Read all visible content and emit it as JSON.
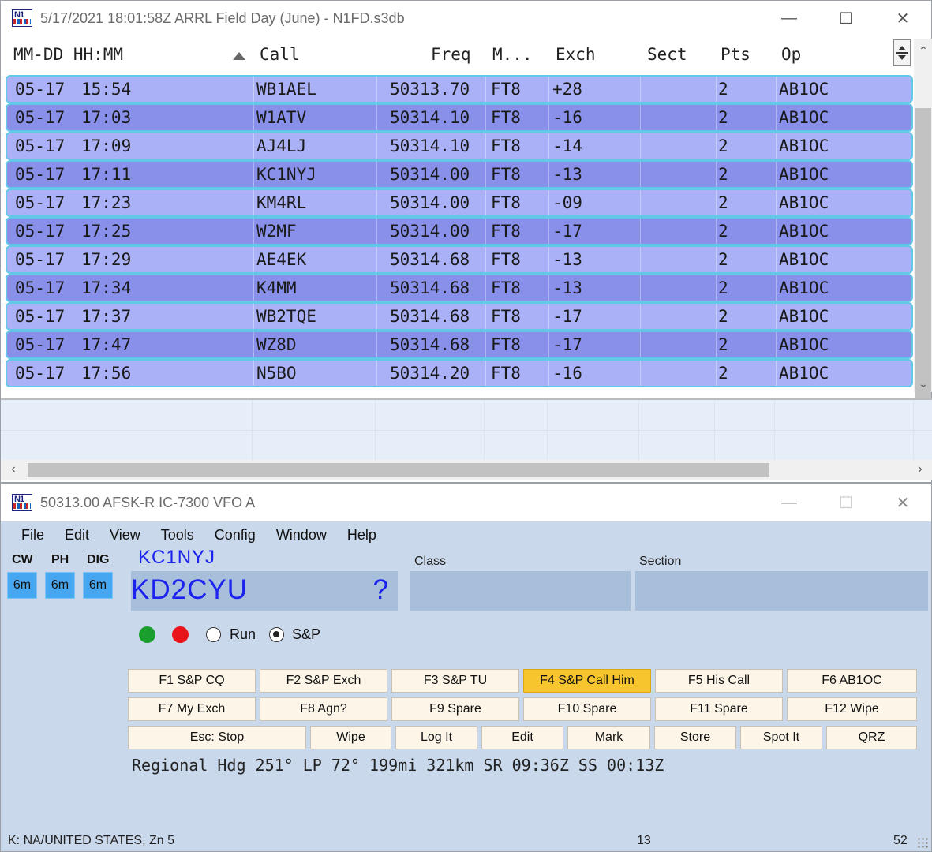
{
  "log_window": {
    "title": "5/17/2021 18:01:58Z  ARRL Field Day (June) - N1FD.s3db",
    "columns": {
      "datetime": "MM-DD HH:MM",
      "call": "Call",
      "freq": "Freq",
      "mode": "M...",
      "exch": "Exch",
      "sect": "Sect",
      "pts": "Pts",
      "op": "Op"
    },
    "rows": [
      {
        "date": "05-17",
        "time": "15:54",
        "call": "WB1AEL",
        "freq": "50313.70",
        "mode": "FT8",
        "exch": "+28",
        "sect": "",
        "pts": "2",
        "op": "AB1OC"
      },
      {
        "date": "05-17",
        "time": "17:03",
        "call": "W1ATV",
        "freq": "50314.10",
        "mode": "FT8",
        "exch": "-16",
        "sect": "",
        "pts": "2",
        "op": "AB1OC"
      },
      {
        "date": "05-17",
        "time": "17:09",
        "call": "AJ4LJ",
        "freq": "50314.10",
        "mode": "FT8",
        "exch": "-14",
        "sect": "",
        "pts": "2",
        "op": "AB1OC"
      },
      {
        "date": "05-17",
        "time": "17:11",
        "call": "KC1NYJ",
        "freq": "50314.00",
        "mode": "FT8",
        "exch": "-13",
        "sect": "",
        "pts": "2",
        "op": "AB1OC"
      },
      {
        "date": "05-17",
        "time": "17:23",
        "call": "KM4RL",
        "freq": "50314.00",
        "mode": "FT8",
        "exch": "-09",
        "sect": "",
        "pts": "2",
        "op": "AB1OC"
      },
      {
        "date": "05-17",
        "time": "17:25",
        "call": "W2MF",
        "freq": "50314.00",
        "mode": "FT8",
        "exch": "-17",
        "sect": "",
        "pts": "2",
        "op": "AB1OC"
      },
      {
        "date": "05-17",
        "time": "17:29",
        "call": "AE4EK",
        "freq": "50314.68",
        "mode": "FT8",
        "exch": "-13",
        "sect": "",
        "pts": "2",
        "op": "AB1OC"
      },
      {
        "date": "05-17",
        "time": "17:34",
        "call": "K4MM",
        "freq": "50314.68",
        "mode": "FT8",
        "exch": "-13",
        "sect": "",
        "pts": "2",
        "op": "AB1OC"
      },
      {
        "date": "05-17",
        "time": "17:37",
        "call": "WB2TQE",
        "freq": "50314.68",
        "mode": "FT8",
        "exch": "-17",
        "sect": "",
        "pts": "2",
        "op": "AB1OC"
      },
      {
        "date": "05-17",
        "time": "17:47",
        "call": "WZ8D",
        "freq": "50314.68",
        "mode": "FT8",
        "exch": "-17",
        "sect": "",
        "pts": "2",
        "op": "AB1OC"
      },
      {
        "date": "05-17",
        "time": "17:56",
        "call": "N5BO",
        "freq": "50314.20",
        "mode": "FT8",
        "exch": "-16",
        "sect": "",
        "pts": "2",
        "op": "AB1OC"
      }
    ]
  },
  "entry_window": {
    "title": "50313.00 AFSK-R IC-7300 VFO A",
    "menu": [
      "File",
      "Edit",
      "View",
      "Tools",
      "Config",
      "Window",
      "Help"
    ],
    "modes": [
      {
        "label": "CW",
        "band": "6m"
      },
      {
        "label": "PH",
        "band": "6m"
      },
      {
        "label": "DIG",
        "band": "6m"
      }
    ],
    "last_call": "KC1NYJ",
    "call_input": "KD2CYU",
    "call_flag": "?",
    "class_label": "Class",
    "section_label": "Section",
    "class_value": "",
    "section_value": "",
    "indicator_colors": {
      "green": "#1a9e2e",
      "red": "#e8141a"
    },
    "run_label": "Run",
    "sp_label": "S&P",
    "selected_mode": "S&P",
    "fkeys_row1": [
      "F1 S&P CQ",
      "F2 S&P Exch",
      "F3 S&P TU",
      "F4 S&P Call Him",
      "F5 His Call",
      "F6 AB1OC"
    ],
    "fkeys_row2": [
      "F7 My Exch",
      "F8 Agn?",
      "F9 Spare",
      "F10 Spare",
      "F11 Spare",
      "F12 Wipe"
    ],
    "buttons_row3": [
      "Esc: Stop",
      "Wipe",
      "Log It",
      "Edit",
      "Mark",
      "Store",
      "Spot It",
      "QRZ"
    ],
    "active_fkey": "F4 S&P Call Him",
    "info_line": "Regional Hdg 251° LP 72° 199mi 321km SR 09:36Z SS 00:13Z",
    "status": {
      "country": "K: NA/UNITED STATES, Zn 5",
      "count": "13",
      "right": "52"
    }
  }
}
